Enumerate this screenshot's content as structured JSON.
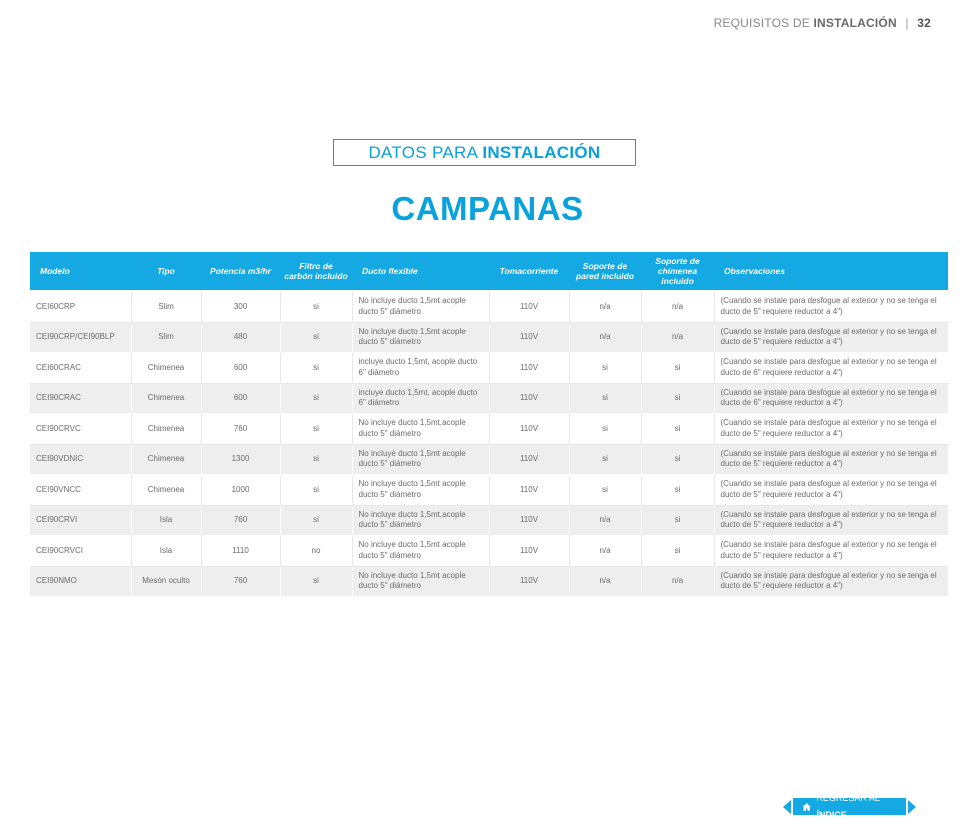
{
  "header": {
    "section_light": "REQUISITOS DE",
    "section_bold": "INSTALACIÓN",
    "separator": "|",
    "page_number": "32"
  },
  "section_box": {
    "light": "DATOS PARA",
    "bold": "INSTALACIÓN"
  },
  "title": "CAMPANAS",
  "table": {
    "headers": [
      "Modelo",
      "Tipo",
      "Potencia m3/hr",
      "Filtro de carbón incluido",
      "Ducto flexible",
      "Tomacorriente",
      "Soporte de pared incluido",
      "Soporte de chimenea incluido",
      "Observaciones"
    ],
    "rows": [
      [
        "CEI60CRP",
        "Slim",
        "300",
        "si",
        "No incluye ducto 1,5mt acople ducto 5\" diámetro",
        "110V",
        "n/a",
        "n/a",
        "(Cuando se instale para desfogue al exterior y no se tenga el ducto de 5\" requiere reductor a 4\")"
      ],
      [
        "CEI90CRP/CEI90BLP",
        "Slim",
        "480",
        "si",
        "No incluye ducto 1,5mt acople ducto 5\" diámetro",
        "110V",
        "n/a",
        "n/a",
        "(Cuando se instale para desfogue al exterior y no se tenga el ducto de 5\" requiere reductor a 4\")"
      ],
      [
        "CEI60CRAC",
        "Chimenea",
        "600",
        "si",
        "incluye ducto 1,5mt, acople ducto 6\" diámetro",
        "110V",
        "si",
        "si",
        "(Cuando se instale para desfogue al exterior y no se tenga el ducto de 6\" requiere reductor a 4\")"
      ],
      [
        "CEI90CRAC",
        "Chimenea",
        "600",
        "si",
        "incluye ducto 1,5mt, acople ducto 6\" diámetro",
        "110V",
        "si",
        "si",
        "(Cuando se instale para desfogue al exterior y no se tenga el ducto de 6\" requiere reductor a 4\")"
      ],
      [
        "CEI90CRVC",
        "Chimenea",
        "760",
        "si",
        "No incluye ducto 1,5mt,acople ducto 5\" diámetro",
        "110V",
        "si",
        "si",
        "(Cuando se instale para desfogue al exterior y no se tenga el ducto de 5\" requiere reductor a 4\")"
      ],
      [
        "CEI90VDNIC",
        "Chimenea",
        "1300",
        "si",
        "No incluye ducto 1,5mt acople ducto 5\" diámetro",
        "110V",
        "si",
        "si",
        "(Cuando se instale para desfogue al exterior y no se tenga el ducto de 5\" requiere reductor a 4\")"
      ],
      [
        "CEI90VNCC",
        "Chimenea",
        "1000",
        "si",
        "No incluye ducto 1,5mt acople ducto 5\" diámetro",
        "110V",
        "si",
        "si",
        "(Cuando se instale para desfogue al exterior y no se tenga el ducto de 5\" requiere reductor a 4\")"
      ],
      [
        "CEI90CRVI",
        "Isla",
        "760",
        "si",
        "No incluye ducto 1,5mt,acople ducto 5\" diámetro",
        "110V",
        "n/a",
        "si",
        "(Cuando se instale para desfogue al exterior y no se tenga el ducto de 5\" requiere reductor a 4\")"
      ],
      [
        "CEI90CRVCI",
        "Isla",
        "1110",
        "no",
        "No incluye ducto 1,5mt acople ducto 5\" diámetro",
        "110V",
        "n/a",
        "si",
        "(Cuando se instale para desfogue al exterior y no se tenga el ducto de 5\" requiere reductor a 4\")"
      ],
      [
        "CEI90NMO",
        "Mesón oculto",
        "760",
        "si",
        "No incluye ducto 1,5mt acople ducto 5\" diámetro",
        "110V",
        "n/a",
        "n/a",
        "(Cuando se instale para desfogue al exterior y no se tenga el ducto de 5\" requiere reductor a 4\")"
      ]
    ]
  },
  "back_button": {
    "light": "REGRESAR AL",
    "bold": "ÍNDICE",
    "icon": "home-icon"
  },
  "colors": {
    "accent": "#14a9e2",
    "row_alt": "#eeeeee"
  }
}
